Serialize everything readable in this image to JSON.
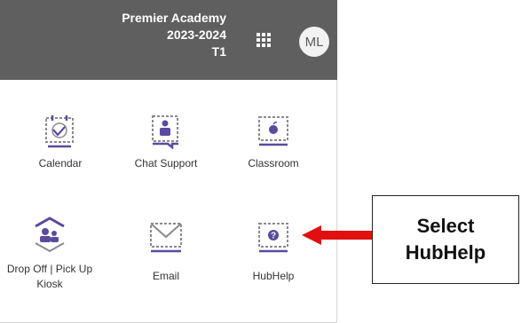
{
  "header": {
    "school_name": "Premier Academy",
    "school_year": "2023-2024",
    "term": "T1",
    "avatar_initials": "ML",
    "apps_icon": "grid-icon"
  },
  "tiles": [
    {
      "label": "Calendar",
      "icon": "calendar-icon"
    },
    {
      "label": "Chat Support",
      "icon": "chat-support-icon"
    },
    {
      "label": "Classroom",
      "icon": "classroom-icon"
    },
    {
      "label": "Drop Off | Pick Up Kiosk",
      "icon": "kiosk-icon"
    },
    {
      "label": "Email",
      "icon": "email-icon"
    },
    {
      "label": "HubHelp",
      "icon": "help-icon"
    }
  ],
  "callout": {
    "text": "Select HubHelp"
  },
  "colors": {
    "header_bg": "#5f5f5f",
    "icon_purple": "#5b4a9e",
    "arrow_red": "#e01010"
  }
}
